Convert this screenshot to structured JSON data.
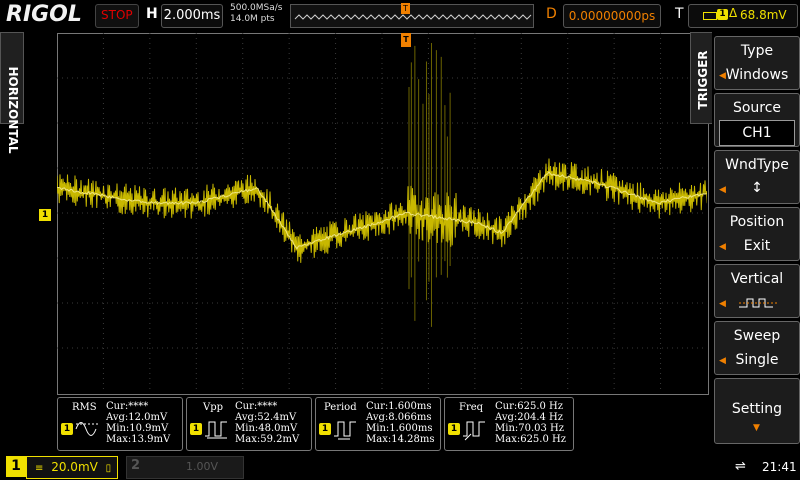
{
  "brand": "RIGOL",
  "status": {
    "run_state": "STOP",
    "state_color": "#e00000"
  },
  "horizontal": {
    "label": "H",
    "timebase": "2.000ms",
    "sample_rate": "500.0MSa/s",
    "memory_depth": "14.0M pts",
    "delay_label": "D",
    "delay": "0.00000000ps",
    "side_tab": "HORIZONTAL"
  },
  "trigger": {
    "label": "T",
    "channel": "1",
    "level": "68.8mV",
    "side_tab": "TRIGGER",
    "marker": "T",
    "menu": [
      {
        "title": "Type",
        "value": "Windows"
      },
      {
        "title": "Source",
        "value": "CH1"
      },
      {
        "title": "WndType",
        "value": "↕"
      },
      {
        "title": "Position",
        "value": "Exit"
      },
      {
        "title": "Vertical",
        "value": ""
      },
      {
        "title": "Sweep",
        "value": "Single"
      },
      {
        "title": "Setting",
        "value": ""
      }
    ]
  },
  "channel1": {
    "number": "1",
    "scale": "20.0mV",
    "color": "#f0e000",
    "marker": "1"
  },
  "channel2": {
    "number": "2",
    "scale": "1.00V"
  },
  "measurements": [
    {
      "name": "RMS",
      "lines": [
        "Cur:****",
        "Avg:12.0mV",
        "Min:10.9mV",
        "Max:13.9mV"
      ],
      "channel": "1"
    },
    {
      "name": "Vpp",
      "lines": [
        "Cur:****",
        "Avg:52.4mV",
        "Min:48.0mV",
        "Max:59.2mV"
      ],
      "channel": "1"
    },
    {
      "name": "Period",
      "lines": [
        "Cur:1.600ms",
        "Avg:8.066ms",
        "Min:1.600ms",
        "Max:14.28ms"
      ],
      "channel": "1"
    },
    {
      "name": "Freq",
      "lines": [
        "Cur:625.0 Hz",
        "Avg:204.4 Hz",
        "Min:70.03 Hz",
        "Max:625.0 Hz"
      ],
      "channel": "1"
    }
  ],
  "system": {
    "usb_icon": "usb-icon",
    "time": "21:41"
  },
  "colors": {
    "accent_orange": "#f08000",
    "trace": "#d8c800"
  }
}
